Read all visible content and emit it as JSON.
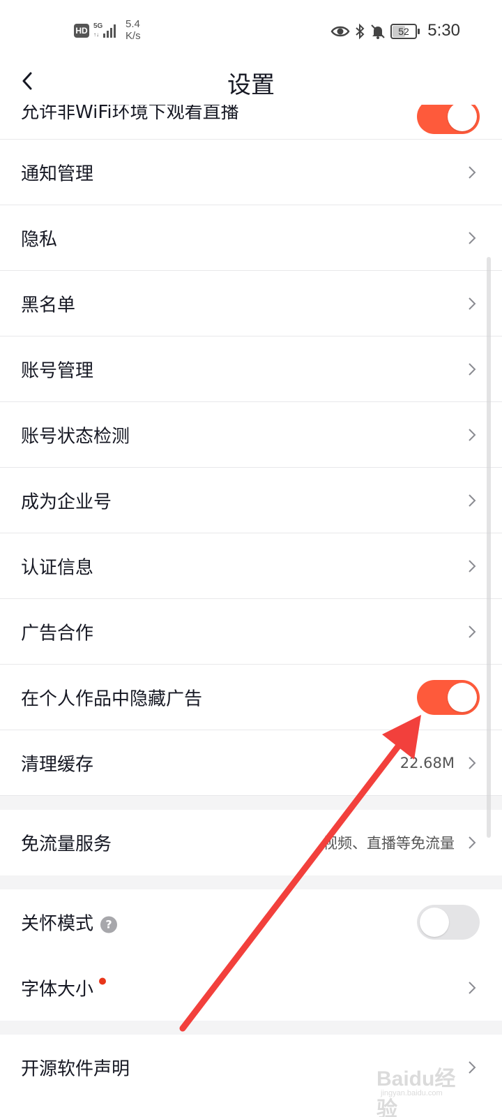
{
  "status_bar": {
    "hd_badge": "HD",
    "network_type": "5G",
    "speed_value": "5.4",
    "speed_unit": "K/s",
    "battery_level": "52",
    "time": "5:30",
    "icons": [
      "hd-icon",
      "signal-5g-icon",
      "eye-comfort-icon",
      "bluetooth-icon",
      "mute-icon",
      "battery-icon"
    ]
  },
  "header": {
    "title": "设置",
    "back_icon": "chevron-left-icon"
  },
  "settings": {
    "partial_row": {
      "label": "允许非WiFi环境下观看直播",
      "toggle_on": true
    },
    "items": [
      {
        "label": "通知管理"
      },
      {
        "label": "隐私"
      },
      {
        "label": "黑名单"
      },
      {
        "label": "账号管理"
      },
      {
        "label": "账号状态检测"
      },
      {
        "label": "成为企业号"
      },
      {
        "label": "认证信息"
      },
      {
        "label": "广告合作"
      }
    ],
    "hide_ads": {
      "label": "在个人作品中隐藏广告",
      "toggle_on": true
    },
    "clear_cache": {
      "label": "清理缓存",
      "value": "22.68M"
    },
    "free_data": {
      "label": "免流量服务",
      "value": "视频、直播等免流量"
    },
    "care_mode": {
      "label": "关怀模式",
      "help_glyph": "?",
      "toggle_on": false
    },
    "font_size": {
      "label": "字体大小"
    },
    "open_source": {
      "label": "开源软件声明"
    }
  },
  "colors": {
    "accent": "#fe5a3b",
    "toggle_off": "#e4e4e6",
    "divider": "#e8e8ea",
    "section_gap": "#f4f4f5",
    "annotation_arrow": "#f2403c",
    "red_dot": "#e8361a"
  },
  "watermark": {
    "text": "Baidu经验",
    "sub": "jingyan.baidu.com"
  }
}
